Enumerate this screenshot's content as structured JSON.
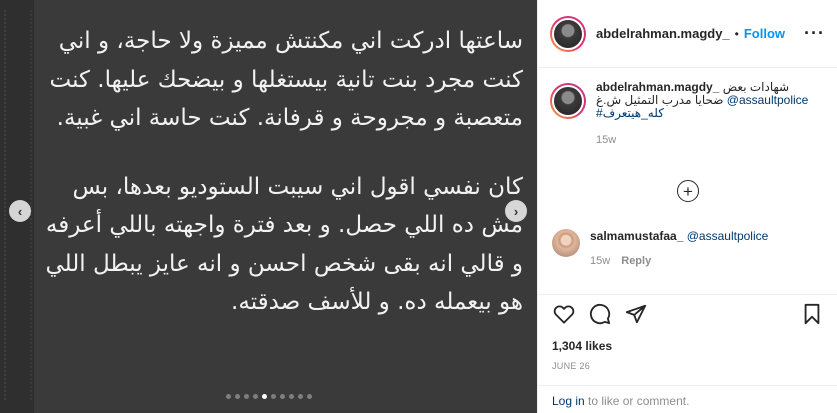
{
  "post": {
    "paragraphs": [
      "ساعتها ادركت اني مكنتش مميزة ولا حاجة، و اني كنت مجرد بنت تانية بيستغلها و بيضحك عليها. كنت متعصبة و مجروحة و قرفانة. كنت حاسة اني غبية.",
      "كان نفسي اقول اني سيبت الستوديو بعدها، بس مش ده اللي حصل. و بعد فترة واجهته باللي أعرفه و قالي انه بقى شخص احسن و انه عايز يبطل اللي هو بيعمله ده. و للأسف صدقته."
    ],
    "nav_prev": "‹",
    "nav_next": "›",
    "active_dot": 4,
    "dot_count": 10
  },
  "header": {
    "username": "abdelrahman.magdy_",
    "separator": "•",
    "follow_label": "Follow",
    "more_label": "···"
  },
  "caption": {
    "username": "abdelrahman.magdy_",
    "text_1": "شهادات بعض",
    "text_2": "ضحايا مدرب التمثيل ش.غ",
    "mention": "@assaultpolice",
    "hashtag": "#كله_هيتعرف",
    "time": "15w"
  },
  "load_more": "+",
  "comment": {
    "username": "salmamustafaa_",
    "mention": "@assaultpolice",
    "time": "15w",
    "reply_label": "Reply"
  },
  "actions": {
    "likes": "1,304 likes",
    "date": "JUNE 26"
  },
  "login": {
    "link": "Log in",
    "rest": " to like or comment."
  }
}
